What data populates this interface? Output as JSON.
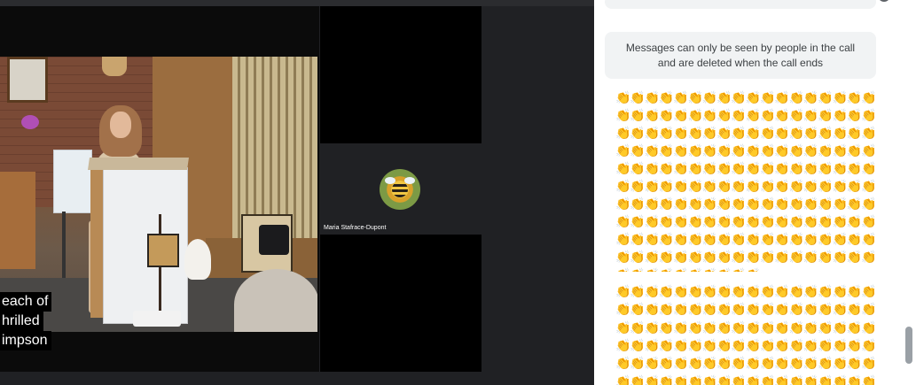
{
  "call": {
    "captions": [
      "each of",
      "hrilled",
      "impson"
    ],
    "participant_name": "Maria Stafrace-Dupont"
  },
  "chat": {
    "notice": "Messages can only be seen by people in the call and are deleted when the call ends",
    "emoji_glyph": "👏",
    "emoji_color": "#e8a317",
    "message_1_count": 190,
    "message_2_count": 108
  }
}
